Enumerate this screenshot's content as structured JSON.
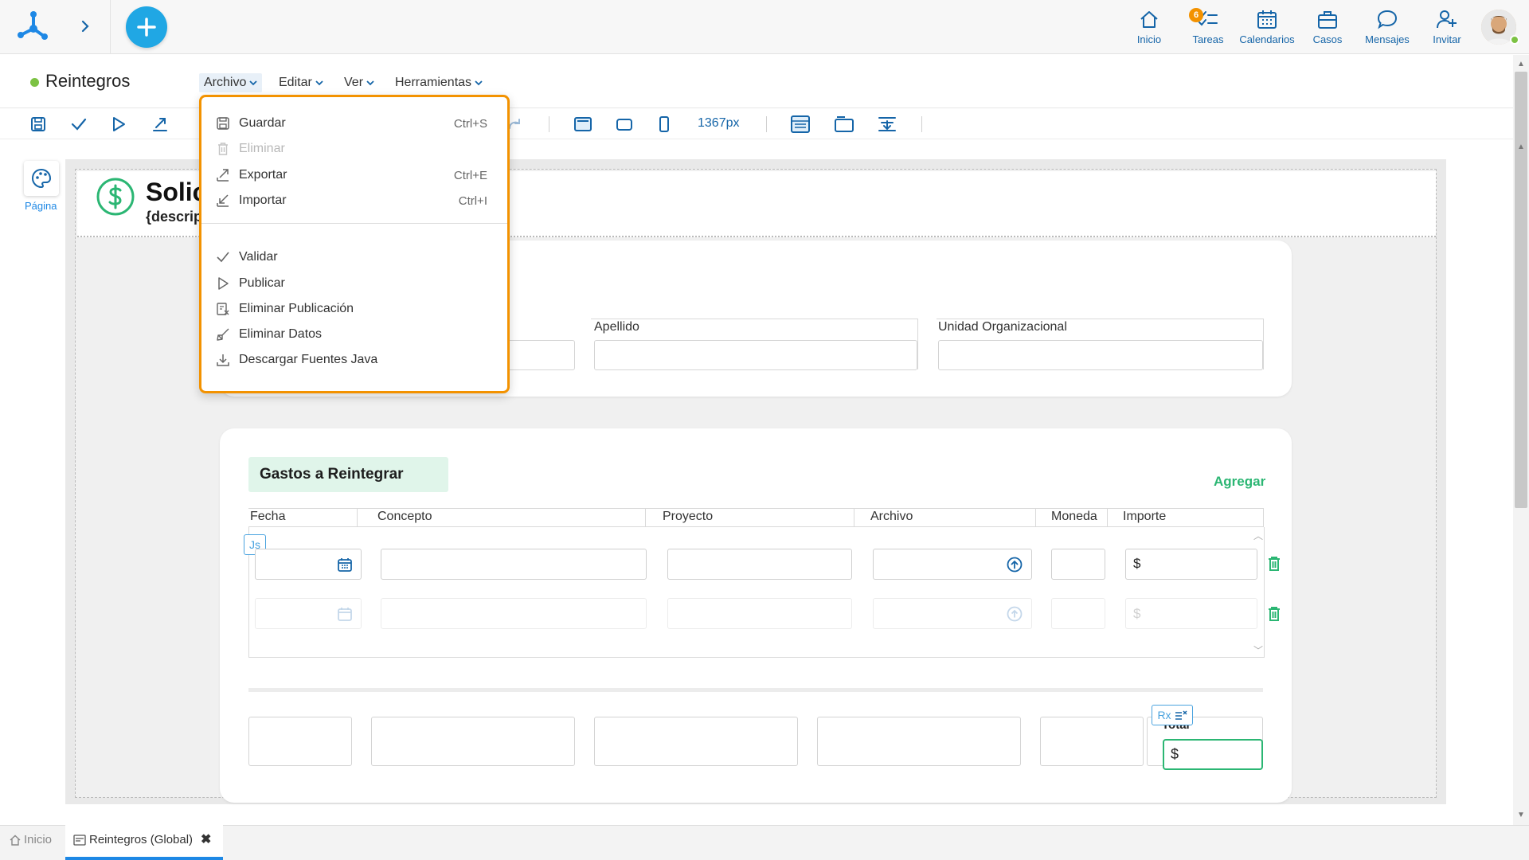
{
  "topnav": {
    "items": [
      {
        "label": "Inicio",
        "icon": "home-icon"
      },
      {
        "label": "Tareas",
        "icon": "tasks-icon",
        "badge": "6"
      },
      {
        "label": "Calendarios",
        "icon": "calendar-icon"
      },
      {
        "label": "Casos",
        "icon": "briefcase-icon"
      },
      {
        "label": "Mensajes",
        "icon": "chat-icon"
      },
      {
        "label": "Invitar",
        "icon": "invite-user-icon"
      }
    ],
    "accent": "#1565a8",
    "badge_color": "#f39200"
  },
  "document": {
    "title": "Reintegros",
    "status_color": "#7cc243"
  },
  "menubar": {
    "items": [
      "Archivo",
      "Editar",
      "Ver",
      "Herramientas"
    ]
  },
  "toolbar": {
    "width_label": "1367px"
  },
  "rail": {
    "page_label": "Página"
  },
  "form": {
    "title": "Solic",
    "description": "{descrip",
    "fields": {
      "apellido": "Apellido",
      "unidad": "Unidad Organizacional"
    },
    "grid": {
      "title": "Gastos a Reintegrar",
      "add_label": "Agregar",
      "columns": [
        "Fecha",
        "Concepto",
        "Proyecto",
        "Archivo",
        "Moneda",
        "Importe"
      ],
      "currency_symbol": "$",
      "js_tag": "Js",
      "rx_tag": "Rx",
      "total_label": "Total",
      "total_currency": "$"
    }
  },
  "dropdown": {
    "items": [
      {
        "label": "Guardar",
        "shortcut": "Ctrl+S",
        "icon": "save-icon",
        "disabled": false
      },
      {
        "label": "Eliminar",
        "shortcut": "",
        "icon": "trash-icon",
        "disabled": true
      },
      {
        "label": "Exportar",
        "shortcut": "Ctrl+E",
        "icon": "export-icon",
        "disabled": false
      },
      {
        "label": "Importar",
        "shortcut": "Ctrl+I",
        "icon": "import-icon",
        "disabled": false
      },
      {
        "label": "Validar",
        "shortcut": "",
        "icon": "check-icon",
        "disabled": false
      },
      {
        "label": "Publicar",
        "shortcut": "",
        "icon": "play-icon",
        "disabled": false
      },
      {
        "label": "Eliminar Publicación",
        "shortcut": "",
        "icon": "unpublish-icon",
        "disabled": false
      },
      {
        "label": "Eliminar Datos",
        "shortcut": "",
        "icon": "clear-data-icon",
        "disabled": false
      },
      {
        "label": "Descargar Fuentes Java",
        "shortcut": "",
        "icon": "download-icon",
        "disabled": false
      }
    ],
    "border_color": "#f39200"
  },
  "bottom_tabs": {
    "home_label": "Inicio",
    "active_label": "Reintegros (Global)",
    "active_color": "#1e88e5"
  }
}
